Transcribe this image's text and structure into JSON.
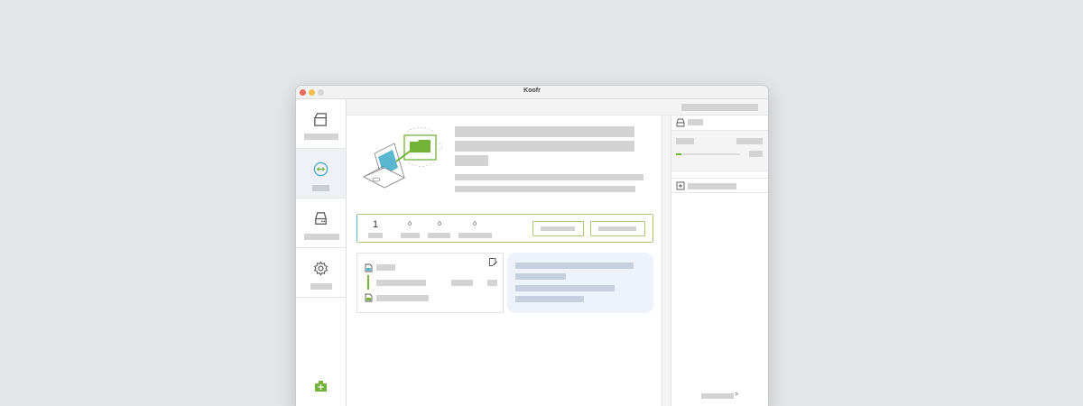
{
  "app": {
    "title": "Koofr"
  },
  "sidebar": {
    "items": [
      {
        "icon": "drive-icon",
        "active": false
      },
      {
        "icon": "sync-icon",
        "active": true
      },
      {
        "icon": "hard-drive-icon",
        "active": false
      },
      {
        "icon": "gear-icon",
        "active": false
      }
    ],
    "logo": "koofr-logo-icon"
  },
  "main": {
    "stats": {
      "values": [
        "1",
        "0",
        "0",
        "0"
      ]
    }
  },
  "right_panel": {
    "footer_glyph": ">",
    "progress": 0.08
  },
  "colors": {
    "accent_green": "#74b33a",
    "accent_blue": "#5bb6d1",
    "sync_active_bg": "#eef2f7",
    "info_bg": "#eef3fb"
  }
}
